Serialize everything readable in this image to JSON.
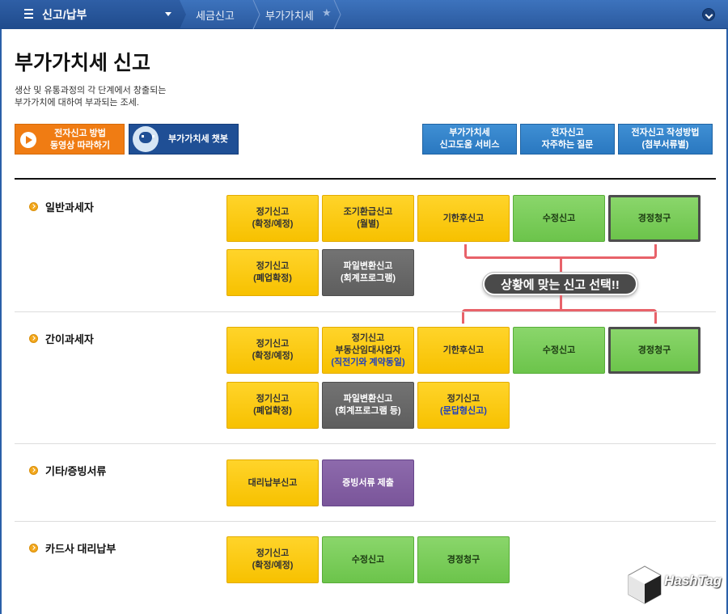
{
  "nav": {
    "menu_title": "신고/납부",
    "crumb1": "세금신고",
    "crumb2": "부가가치세"
  },
  "page": {
    "title": "부가가치세 신고",
    "desc_line1": "생산 및 유통과정의 각 단계에서 창출되는",
    "desc_line2": "부가가치에 대하여 부과되는 조세."
  },
  "top_buttons": {
    "video_line1": "전자신고 방법",
    "video_line2": "동영상 따라하기",
    "chatbot": "부가가치세 챗봇",
    "help_line1": "부가가치세",
    "help_line2": "신고도움 서비스",
    "faq_line1": "전자신고",
    "faq_line2": "자주하는 질문",
    "guide_line1": "전자신고 작성방법",
    "guide_line2": "(첨부서류별)"
  },
  "sections": {
    "general": {
      "label": "일반과세자",
      "regular_1": "정기신고",
      "regular_2": "(확정/예정)",
      "early_1": "조기환급신고",
      "early_2": "(월별)",
      "late": "기한후신고",
      "amend": "수정신고",
      "correct": "경정청구",
      "closure_1": "정기신고",
      "closure_2": "(폐업확정)",
      "file_1": "파일변환신고",
      "file_2": "(회계프로그램)"
    },
    "simple": {
      "label": "간이과세자",
      "regular_1": "정기신고",
      "regular_2": "(확정/예정)",
      "rental_1": "정기신고",
      "rental_2": "부동산임대사업자",
      "rental_3": "(직전기와 계약동일)",
      "late": "기한후신고",
      "amend": "수정신고",
      "correct": "경정청구",
      "closure_1": "정기신고",
      "closure_2": "(폐업확정)",
      "file_1": "파일변환신고",
      "file_2": "(회계프로그램 등)",
      "qa_1": "정기신고",
      "qa_2": "(문답형신고)"
    },
    "other": {
      "label": "기타/증빙서류",
      "agent": "대리납부신고",
      "docs": "증빙서류 제출"
    },
    "card": {
      "label": "카드사 대리납부",
      "regular_1": "정기신고",
      "regular_2": "(확정/예정)",
      "amend": "수정신고",
      "correct": "경정청구"
    }
  },
  "callout": "상황에 맞는 신고 선택!!",
  "watermark": "HashTag",
  "colors": {
    "nav": "#2b5a9f",
    "orange": "#f07c13",
    "blue_btn": "#2a78c0",
    "yellow": "#f7c100",
    "green": "#6cc44b",
    "gray": "#5e5e5e",
    "purple": "#7a559a",
    "bracket": "#e8626a"
  }
}
